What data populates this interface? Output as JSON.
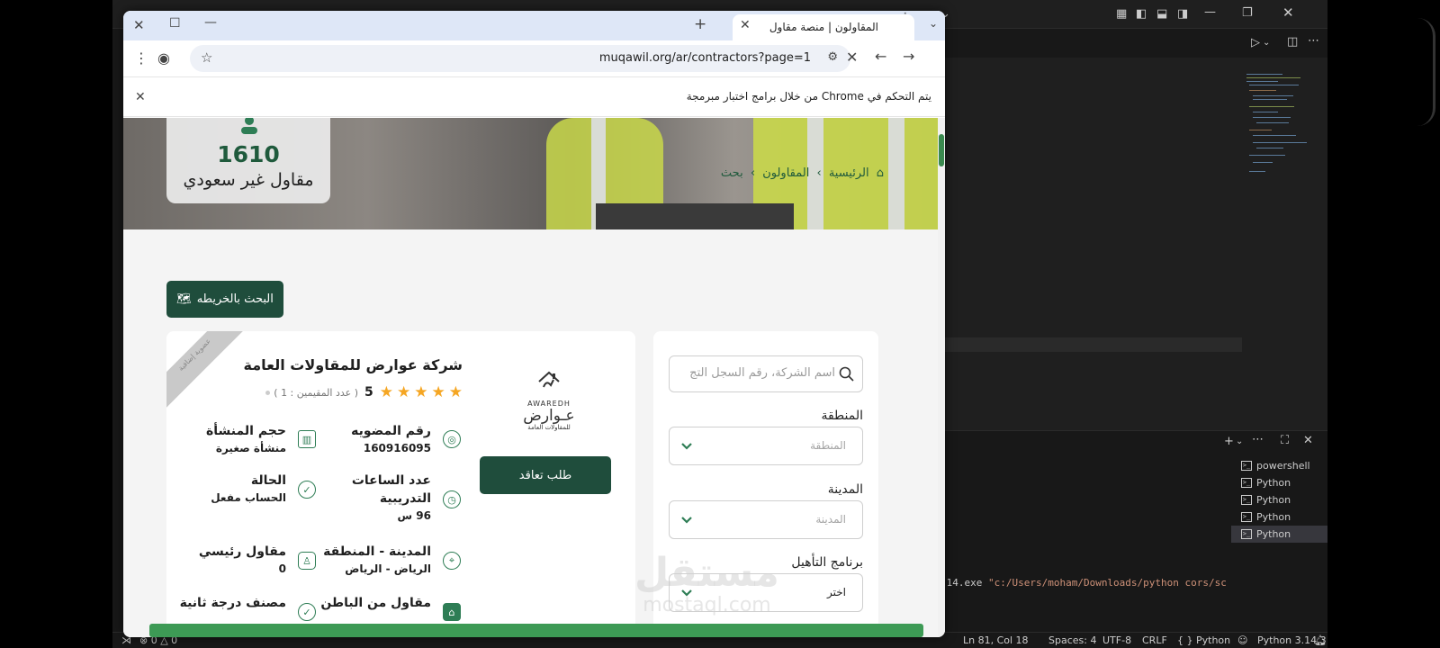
{
  "vscode": {
    "terminals": [
      "powershell",
      "Python",
      "Python",
      "Python",
      "Python"
    ],
    "terminal_command": ".14.exe",
    "terminal_arg": "\"c:/Users/moham/Downloads/python cors/sc",
    "status": {
      "errors": "0",
      "warnings": "0",
      "position": "Ln 81, Col 18",
      "spaces": "Spaces: 4",
      "encoding": "UTF-8",
      "eol": "CRLF",
      "language": "Python",
      "interpreter": "Python 3.14.3"
    }
  },
  "browser": {
    "tab_title": "المقاولون | منصة مقاول",
    "url": "muqawil.org/ar/contractors?page=1",
    "infobar": "يتم التحكم في Chrome من خلال برامج اختبار مبرمجة"
  },
  "page": {
    "stat_number": "1610",
    "stat_label": "مقاول غير سعودي",
    "breadcrumb": [
      "الرئيسية",
      "المقاولون",
      "بحث"
    ],
    "map_button": "البحث بالخريطه",
    "card": {
      "ribbon": "عضوية إضافية",
      "company_name": "شركة عوارض للمقاولات العامة",
      "rating": "5",
      "rating_count": "( عدد المقيمين : 1 )",
      "logo_en": "AWAREDH",
      "logo_ar": "عـوارض",
      "logo_sub": "للمقاولات العامة",
      "contract_button": "طلب تعاقد",
      "fields": {
        "membership_label": "رقم المضويه",
        "membership_value": "160916095",
        "size_label": "حجم المنشأة",
        "size_value": "منشأة صغيرة",
        "hours_label_1": "عدد الساعات",
        "hours_label_2": "التدريبية",
        "hours_value": "96 س",
        "status_label": "الحالة",
        "status_value": "الحساب مفعل",
        "city_label": "المدينة - المنطقة",
        "city_value": "الرياض - الرياض",
        "main_label": "مقاول رئيسي",
        "main_value": "0",
        "sub_label": "مقاول من الباطن",
        "class_label": "مصنف درجة ثانية"
      }
    },
    "filter": {
      "search_placeholder": "اسم الشركة، رقم السجل التج",
      "region_label": "المنطقة",
      "region_placeholder": "المنطقة",
      "city_label": "المدينة",
      "city_placeholder": "المدينة",
      "program_label": "برنامج التأهيل",
      "program_value": "اختر"
    }
  },
  "watermark": {
    "ar": "مستقل",
    "en": "mostaql.com"
  }
}
